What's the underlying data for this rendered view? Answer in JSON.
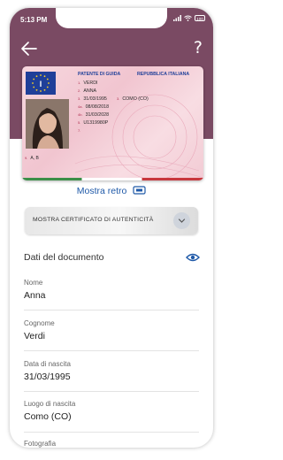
{
  "status_bar": {
    "time": "5:13 PM",
    "icons": [
      "signal-icon",
      "wifi-icon",
      "battery-icon"
    ],
    "battery_level": "100"
  },
  "header": {
    "back_icon": "arrow-left-icon",
    "help_label": "?"
  },
  "license": {
    "title": "PATENTE DI GUIDA",
    "country": "REPUBBLICA ITALIANA",
    "country_code": "I",
    "lines": [
      {
        "num": "1.",
        "value": "VERDI"
      },
      {
        "num": "2.",
        "value": "ANNA"
      },
      {
        "num": "3.",
        "value": "31/03/1995"
      },
      {
        "num": "4a.",
        "value": "08/08/2018"
      },
      {
        "num": "4b.",
        "value": "31/03/2028"
      },
      {
        "num": "5.",
        "value": "U1319980P"
      },
      {
        "num": "7.",
        "value": ""
      }
    ],
    "birthplace": {
      "num": "3.",
      "value": "COMO (CO)"
    },
    "categories": "A, B"
  },
  "back_view": {
    "label": "Mostra retro",
    "icon": "card-flip-icon"
  },
  "certificate": {
    "label": "MOSTRA CERTIFICATO DI AUTENTICITÀ",
    "icon": "chevron-down-icon"
  },
  "document": {
    "title": "Dati del documento",
    "eye_icon": "eye-icon",
    "fields": [
      {
        "label": "Nome",
        "value": "Anna"
      },
      {
        "label": "Cognome",
        "value": "Verdi"
      },
      {
        "label": "Data di nascita",
        "value": "31/03/1995"
      },
      {
        "label": "Luogo di nascita",
        "value": "Como (CO)"
      },
      {
        "label": "Fotografia",
        "value": ""
      }
    ]
  },
  "colors": {
    "header": "#7a4a63",
    "accent": "#1f59a8",
    "card_pink": "#f4d0d9",
    "eu_blue": "#1f3f99"
  }
}
